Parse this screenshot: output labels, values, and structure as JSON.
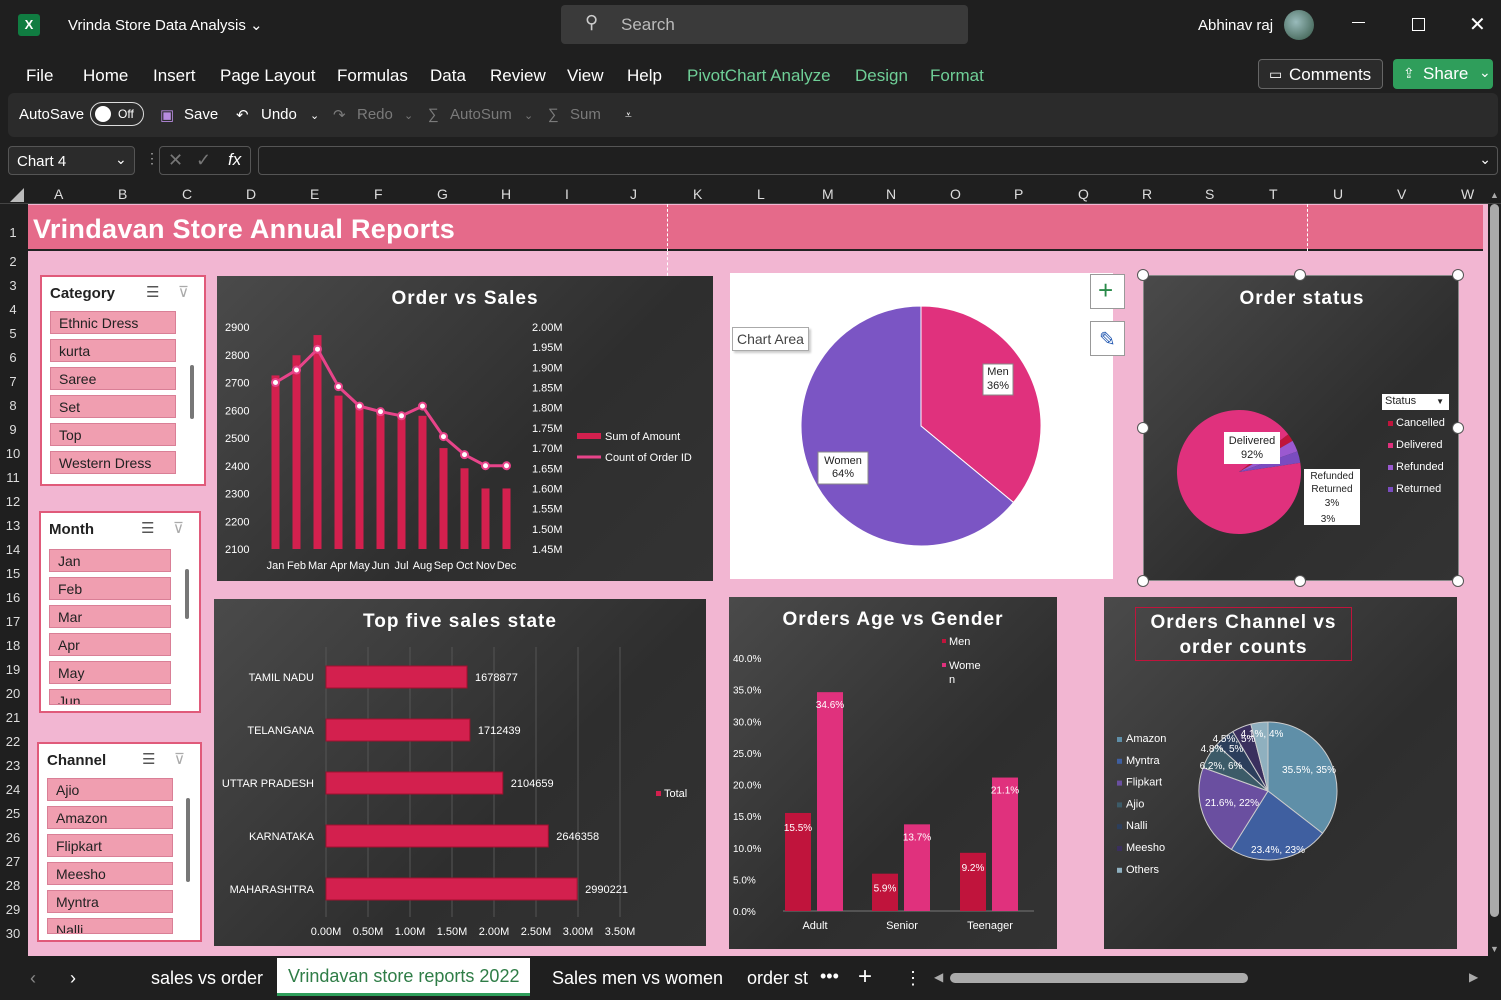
{
  "window": {
    "title": "Vrinda Store Data Analysis",
    "user": "Abhinav raj",
    "search_placeholder": "Search",
    "excel_icon": "X"
  },
  "menu": {
    "items": [
      "File",
      "Home",
      "Insert",
      "Page Layout",
      "Formulas",
      "Data",
      "Review",
      "View",
      "Help",
      "PivotChart Analyze",
      "Design",
      "Format"
    ],
    "comments": "Comments",
    "share": "Share"
  },
  "toolbar": {
    "autosave": "AutoSave",
    "autosave_state": "Off",
    "save": "Save",
    "undo": "Undo",
    "redo": "Redo",
    "autosum": "AutoSum",
    "sum": "Sum"
  },
  "formula": {
    "name_box": "Chart 4",
    "fx": "fx"
  },
  "columns": [
    "A",
    "B",
    "C",
    "D",
    "E",
    "F",
    "G",
    "H",
    "I",
    "J",
    "K",
    "L",
    "M",
    "N",
    "O",
    "P",
    "Q",
    "R",
    "S",
    "T",
    "U",
    "V",
    "W"
  ],
  "rows": [
    "1",
    "2",
    "3",
    "4",
    "5",
    "6",
    "7",
    "8",
    "9",
    "10",
    "11",
    "12",
    "13",
    "14",
    "15",
    "16",
    "17",
    "18",
    "19",
    "20",
    "21",
    "22",
    "23",
    "24",
    "25",
    "26",
    "27",
    "28",
    "29",
    "30"
  ],
  "dashboard": {
    "title": "Vrindavan Store Annual Reports"
  },
  "slicers": {
    "category": {
      "title": "Category",
      "items": [
        "Ethnic Dress",
        "kurta",
        "Saree",
        "Set",
        "Top",
        "Western Dress"
      ]
    },
    "month": {
      "title": "Month",
      "items": [
        "Jan",
        "Feb",
        "Mar",
        "Apr",
        "May",
        "Jun"
      ]
    },
    "channel": {
      "title": "Channel",
      "items": [
        "Ajio",
        "Amazon",
        "Flipkart",
        "Meesho",
        "Myntra",
        "Nalli"
      ]
    }
  },
  "chart_area_tooltip": "Chart Area",
  "chart_data": [
    {
      "type": "bar",
      "title": "Order vs Sales",
      "categories": [
        "Jan",
        "Feb",
        "Mar",
        "Apr",
        "May",
        "Jun",
        "Jul",
        "Aug",
        "Sep",
        "Oct",
        "Nov",
        "Dec"
      ],
      "series": [
        {
          "name": "Sum of Amount",
          "values": [
            1.88,
            1.93,
            1.98,
            1.83,
            1.81,
            1.79,
            1.78,
            1.78,
            1.7,
            1.65,
            1.6,
            1.6
          ]
        },
        {
          "name": "Count of Order ID",
          "values": [
            2700,
            2745,
            2820,
            2685,
            2615,
            2595,
            2580,
            2615,
            2505,
            2440,
            2400,
            2400
          ]
        }
      ],
      "left_ticks": [
        "2100",
        "2200",
        "2300",
        "2400",
        "2500",
        "2600",
        "2700",
        "2800",
        "2900"
      ],
      "right_ticks": [
        "1.45M",
        "1.50M",
        "1.55M",
        "1.60M",
        "1.65M",
        "1.70M",
        "1.75M",
        "1.80M",
        "1.85M",
        "1.90M",
        "1.95M",
        "2.00M"
      ],
      "ylim": [
        2100,
        2900
      ],
      "y2lim": [
        1.45,
        2.0
      ]
    },
    {
      "type": "pie",
      "title": "",
      "slices": [
        {
          "label": "Women",
          "value": 64,
          "text": "64%",
          "color": "#7b55c4"
        },
        {
          "label": "Men",
          "value": 36,
          "text": "36%",
          "color": "#e0317d"
        }
      ]
    },
    {
      "type": "pie",
      "title": "Order status",
      "legend_title": "Status",
      "legend": [
        "Cancelled",
        "Delivered",
        "Refunded",
        "Returned"
      ],
      "slices": [
        {
          "label": "Delivered",
          "value": 92,
          "text": "92%",
          "color": "#e0317d"
        },
        {
          "label": "Refunded",
          "value": 3,
          "text": "3%",
          "color": "#9b59d0"
        },
        {
          "label": "Returned",
          "value": 3,
          "text": "3%",
          "color": "#7a4cc0"
        },
        {
          "label": "Cancelled",
          "value": 2,
          "text": "",
          "color": "#c0143c"
        }
      ],
      "data_labels": {
        "delivered": "Delivered",
        "delivered_pct": "92%",
        "refunded": "Refunded",
        "returned": "Returned",
        "refunded_pct": "3%",
        "returned_pct": "3%"
      }
    },
    {
      "type": "bar",
      "title": "Top five sales state",
      "orientation": "horizontal",
      "categories": [
        "TAMIL NADU",
        "TELANGANA",
        "UTTAR PRADESH",
        "KARNATAKA",
        "MAHARASHTRA"
      ],
      "values": [
        1678877,
        1712439,
        2104659,
        2646358,
        2990221
      ],
      "legend": "Total",
      "x_ticks": [
        "0.00M",
        "0.50M",
        "1.00M",
        "1.50M",
        "2.00M",
        "2.50M",
        "3.00M",
        "3.50M"
      ],
      "xlim": [
        0,
        3.5
      ]
    },
    {
      "type": "bar",
      "title": "Orders Age vs Gender",
      "categories": [
        "Adult",
        "Senior",
        "Teenager"
      ],
      "series": [
        {
          "name": "Men",
          "values": [
            15.5,
            5.9,
            9.2
          ]
        },
        {
          "name": "Women",
          "values": [
            34.6,
            13.7,
            21.1
          ]
        }
      ],
      "legend_men": "Men",
      "legend_women_a": "Wome",
      "legend_women_b": "n",
      "y_ticks": [
        "0.0%",
        "5.0%",
        "10.0%",
        "15.0%",
        "20.0%",
        "25.0%",
        "30.0%",
        "35.0%",
        "40.0%"
      ],
      "ylim": [
        0,
        40
      ],
      "labels": [
        "15.5%",
        "5.9%",
        "9.2%",
        "34.6%",
        "13.7%",
        "21.1%"
      ]
    },
    {
      "type": "pie",
      "title_line1": "Orders Channel vs",
      "title_line2": "order counts",
      "legend": [
        "Amazon",
        "Myntra",
        "Flipkart",
        "Ajio",
        "Nalli",
        "Meesho",
        "Others"
      ],
      "slices": [
        {
          "label": "Amazon",
          "value": 35.5,
          "text": "35.5%, 35%",
          "color": "#5f8fa8"
        },
        {
          "label": "Myntra",
          "value": 23.4,
          "text": "23.4%, 23%",
          "color": "#3f5fa0"
        },
        {
          "label": "Flipkart",
          "value": 21.6,
          "text": "21.6%, 22%",
          "color": "#6a4fa0"
        },
        {
          "label": "Ajio",
          "value": 6.2,
          "text": "6.2%, 6%",
          "color": "#3c5b68"
        },
        {
          "label": "Nalli",
          "value": 4.8,
          "text": "4.8%, 5%",
          "color": "#2c3e5c"
        },
        {
          "label": "Meesho",
          "value": 4.5,
          "text": "4.5%, 5%",
          "color": "#3a2f5e"
        },
        {
          "label": "Others",
          "value": 4.0,
          "text": "4.1%, 4%",
          "color": "#8fb0bf"
        }
      ]
    }
  ],
  "sheet_tabs": [
    "sales vs order",
    "Vrindavan store reports 2022",
    "Sales men vs women",
    "order st"
  ]
}
